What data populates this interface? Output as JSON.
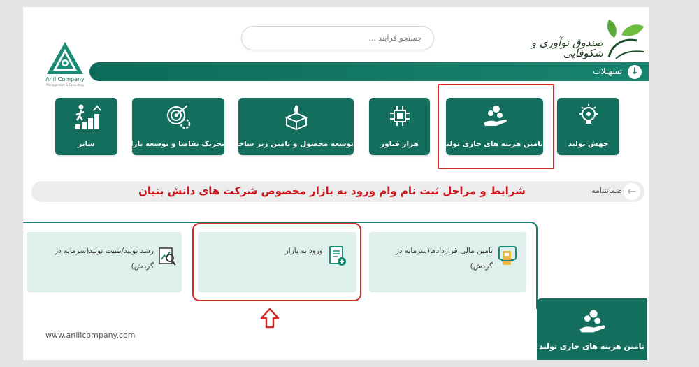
{
  "header": {
    "search_placeholder": "جستجو فرآیند ...",
    "left_logo": {
      "name": "Anil Company",
      "subtitle": "Management & Consulting"
    },
    "right_logo": {
      "name": "صندوق نوآوری و شکوفایی"
    },
    "nav_bar_label": "تسهیلات"
  },
  "tiles": [
    {
      "label": "جهش تولید",
      "icon": "lightbulb-gear-icon"
    },
    {
      "label": "تامین هزینه های جاری تولید",
      "icon": "hand-coins-icon"
    },
    {
      "label": "هزار فناور",
      "icon": "chip-gear-icon"
    },
    {
      "label": "توسعه محصول و تامین زیر ساخت",
      "icon": "box-rocket-icon"
    },
    {
      "label": "تحریک تقاضا و توسعه بازار",
      "icon": "target-gear-icon"
    },
    {
      "label": "سایر",
      "icon": "growth-stairs-icon"
    }
  ],
  "banner": {
    "title": "شرایط و مراحل ثبت نام وام ورود به بازار مخصوص شرکت های دانش بنیان",
    "link": "ضمانتنامه"
  },
  "cards": [
    {
      "label": "تامین مالی قراردادها(سرمایه در گردش)",
      "icon": "atm-card-icon"
    },
    {
      "label": "ورود به بازار",
      "icon": "document-add-icon"
    },
    {
      "label": "رشد تولید/تثبیت تولید(سرمایه در گردش)",
      "icon": "chart-magnifier-icon"
    }
  ],
  "footer": {
    "website": "www.aniilcompany.com",
    "selected_tile": "تامین هزینه های جاری تولید"
  },
  "colors": {
    "primary": "#146e5d",
    "highlight": "#d42a2a",
    "card_bg": "#dff0ec",
    "banner_text": "#c8161d"
  }
}
